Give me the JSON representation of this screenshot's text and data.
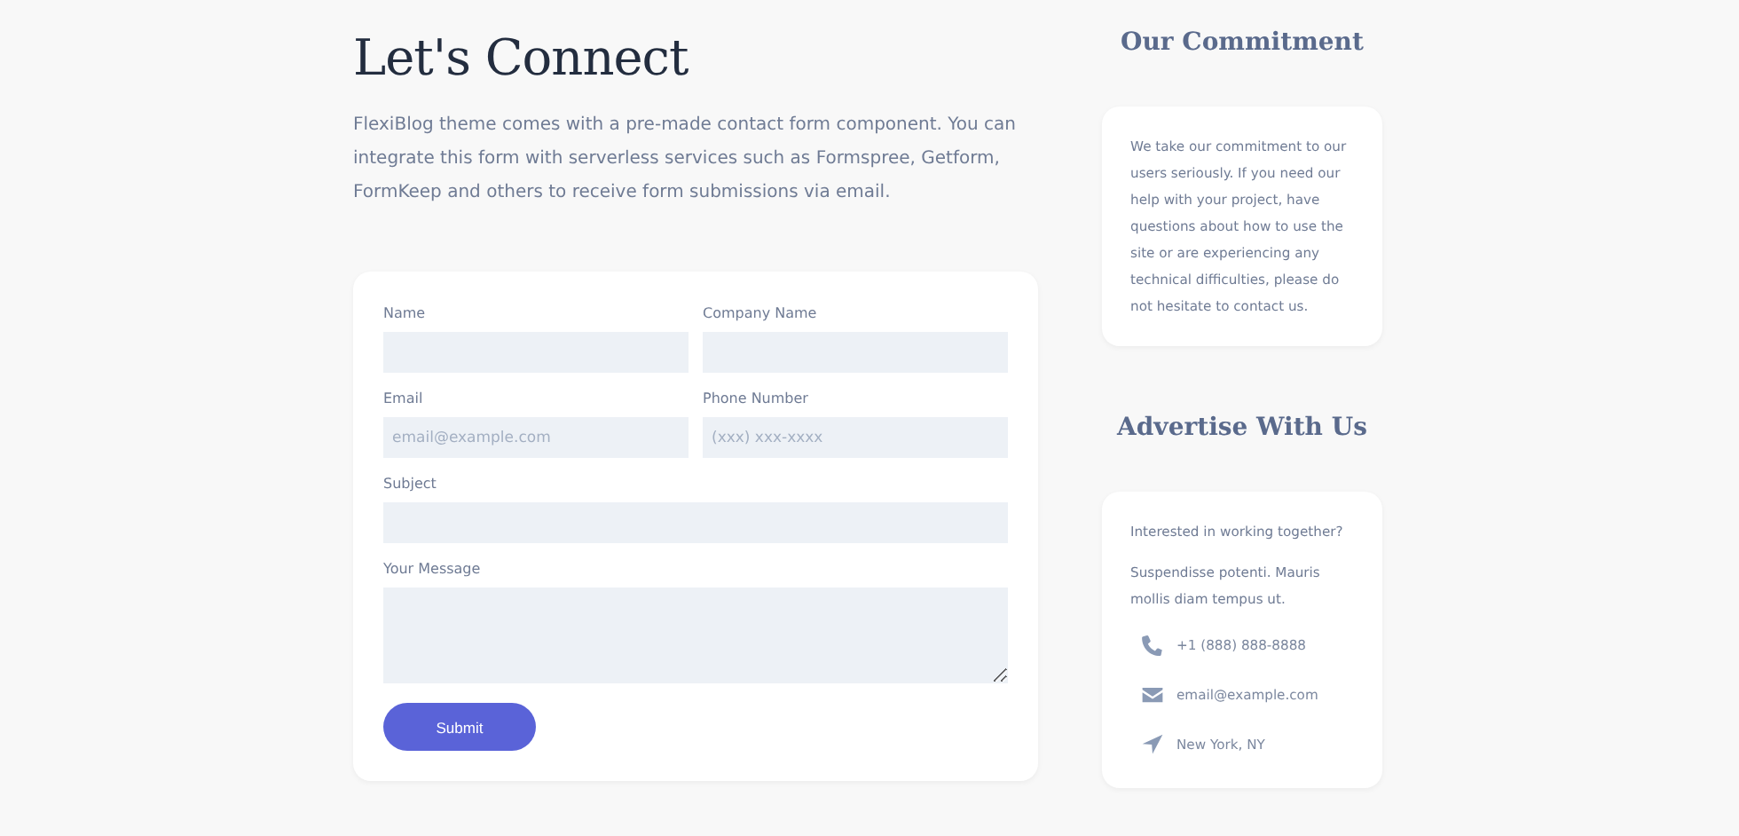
{
  "header": {
    "title": "Let's Connect",
    "intro": "FlexiBlog theme comes with a pre-made contact form component. You can integrate this form with serverless services such as Formspree, Getform, FormKeep and others to receive form submissions via email."
  },
  "form": {
    "fields": [
      {
        "label": "Name",
        "kind": "half"
      },
      {
        "label": "Company Name",
        "kind": "half"
      },
      {
        "label": "Email",
        "kind": "half",
        "placeholder": "email@example.com"
      },
      {
        "label": "Phone Number",
        "kind": "half",
        "placeholder": "(xxx) xxx-xxxx"
      },
      {
        "label": "Subject",
        "kind": "full"
      },
      {
        "label": "Your Message",
        "kind": "textarea"
      }
    ],
    "submit": "Submit"
  },
  "sidebar": [
    {
      "heading": "Our Commitment",
      "paragraphs": [
        "We take our commitment to our users seriously. If you need our help with your project, have questions about how to use the site or are experiencing any technical difficulties, please do not hesitate to contact us."
      ]
    },
    {
      "heading": "Advertise With Us",
      "paragraphs": [
        "Interested in working together?",
        "Suspendisse potenti. Mauris mollis diam tempus ut."
      ],
      "contacts": [
        {
          "kind": "phone",
          "text": "+1 (888) 888-8888"
        },
        {
          "kind": "email",
          "text": "email@example.com"
        },
        {
          "kind": "location",
          "text": "New York, NY"
        }
      ]
    }
  ]
}
